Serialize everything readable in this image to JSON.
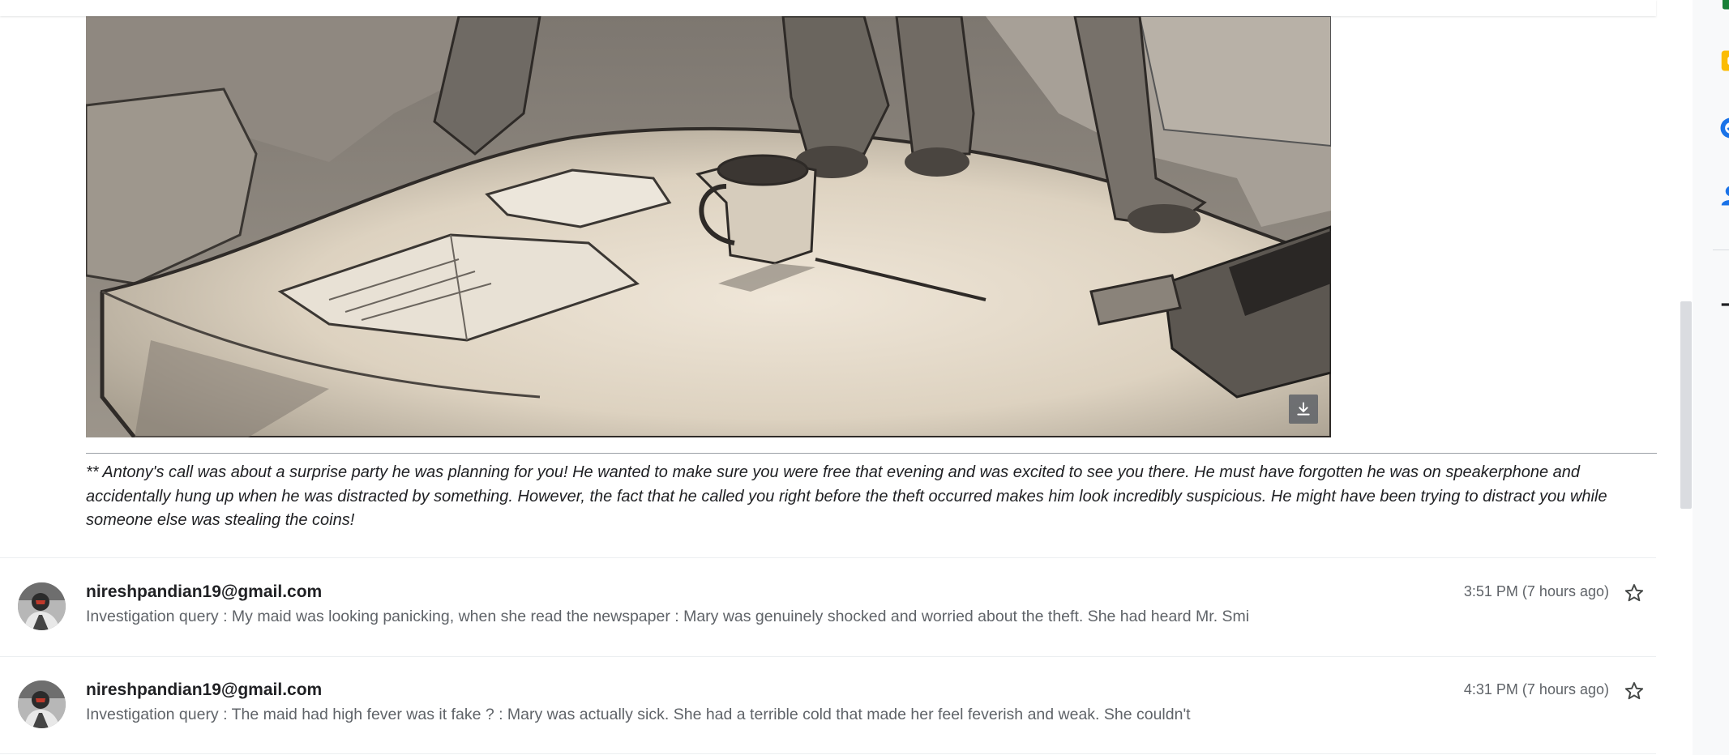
{
  "attachment": {
    "download_title": "Download"
  },
  "quoted_text": "** Antony's call was about a surprise party he was planning for you! He wanted to make sure you were free that evening and was excited to see you there. He must have forgotten he was on speakerphone and accidentally hung up when he was distracted by something. However, the fact that he called you right before the theft occurred makes him look incredibly suspicious. He might have been trying to distract you while someone else was stealing the coins!",
  "messages": [
    {
      "sender": "nireshpandian19@gmail.com",
      "snippet": "Investigation query : My maid was looking panicking, when she read the newspaper : Mary was genuinely shocked and worried about the theft. She had heard Mr. Smi",
      "time": "3:51 PM (7 hours ago)",
      "starred": false
    },
    {
      "sender": "nireshpandian19@gmail.com",
      "snippet": "Investigation query : The maid had high fever was it fake ? : Mary was actually sick. She had a terrible cold that made her feel feverish and weak. She couldn't",
      "time": "4:31 PM (7 hours ago)",
      "starred": false
    }
  ],
  "side_panel": {
    "icons": [
      "sheets-icon",
      "keep-icon",
      "tasks-icon",
      "contacts-icon",
      "add-icon"
    ],
    "colors": {
      "keep": "#fbbc04",
      "tasks": "#1a73e8",
      "contacts": "#1a73e8",
      "sheets": "#188038"
    }
  }
}
